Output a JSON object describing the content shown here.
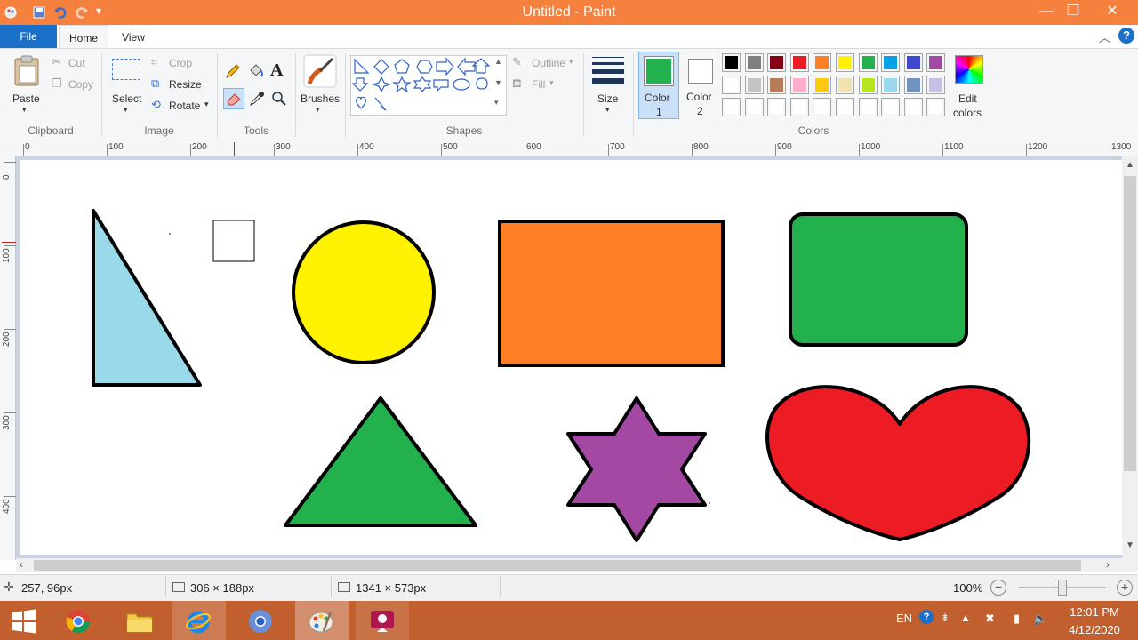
{
  "window": {
    "title": "Untitled - Paint",
    "controls": [
      "minimize",
      "maximize",
      "close"
    ]
  },
  "quick_access": [
    "paint-menu-icon",
    "save-icon",
    "undo-icon",
    "redo-icon",
    "customize-dropdown-icon"
  ],
  "tabs": {
    "file": "File",
    "home": "Home",
    "view": "View"
  },
  "ribbon": {
    "clipboard": {
      "label": "Clipboard",
      "paste": "Paste",
      "cut": "Cut",
      "copy": "Copy"
    },
    "image": {
      "label": "Image",
      "select": "Select",
      "crop": "Crop",
      "resize": "Resize",
      "rotate": "Rotate"
    },
    "tools": {
      "label": "Tools",
      "items": [
        "pencil-icon",
        "fill-bucket-icon",
        "text-icon",
        "eraser-icon",
        "color-picker-icon",
        "magnifier-icon"
      ]
    },
    "brushes": {
      "label": "Brushes"
    },
    "shapes": {
      "label": "Shapes",
      "outline": "Outline",
      "fill": "Fill"
    },
    "size": {
      "label": "Size"
    },
    "colors": {
      "label": "Colors",
      "color1_label": "Color",
      "color1_num": "1",
      "color2_label": "Color",
      "color2_num": "2",
      "color1_value": "#22b14c",
      "color2_value": "#ffffff",
      "edit_label": "Edit",
      "edit_label2": "colors",
      "palette_row1": [
        "#000000",
        "#7f7f7f",
        "#880015",
        "#ed1c24",
        "#ff7f27",
        "#fff200",
        "#22b14c",
        "#00a2e8",
        "#3f48cc",
        "#a349a4"
      ],
      "palette_row2": [
        "#ffffff",
        "#c3c3c3",
        "#b97a57",
        "#ffaec9",
        "#ffc90e",
        "#efe4b0",
        "#b5e61d",
        "#99d9ea",
        "#7092be",
        "#c8bfe7"
      ]
    }
  },
  "ruler": {
    "top_marks": [
      "0",
      "100",
      "200",
      "300",
      "400",
      "500",
      "600",
      "700",
      "800",
      "900",
      "1000",
      "1100",
      "1200",
      "1300"
    ],
    "left_marks": [
      "0",
      "100",
      "200",
      "300",
      "400"
    ]
  },
  "canvas_shapes": {
    "right_triangle_fill": "#99d9ea",
    "circle_fill": "#fff200",
    "rectangle_fill": "#ff7f27",
    "rounded_rectangle_fill": "#22b14c",
    "triangle_fill": "#22b14c",
    "star_fill": "#a349a4",
    "heart_fill": "#ed1c24"
  },
  "status": {
    "cursor": "257, 96px",
    "selection": "306 × 188px",
    "canvas_size": "1341 × 573px",
    "zoom": "100%"
  },
  "taskbar": {
    "apps": [
      "windows-start-icon",
      "chrome-icon",
      "file-explorer-icon",
      "internet-explorer-icon",
      "chrome-alt-icon",
      "paint-icon",
      "media-icon"
    ],
    "language": "EN",
    "time": "12:01 PM",
    "date": "4/12/2020"
  }
}
